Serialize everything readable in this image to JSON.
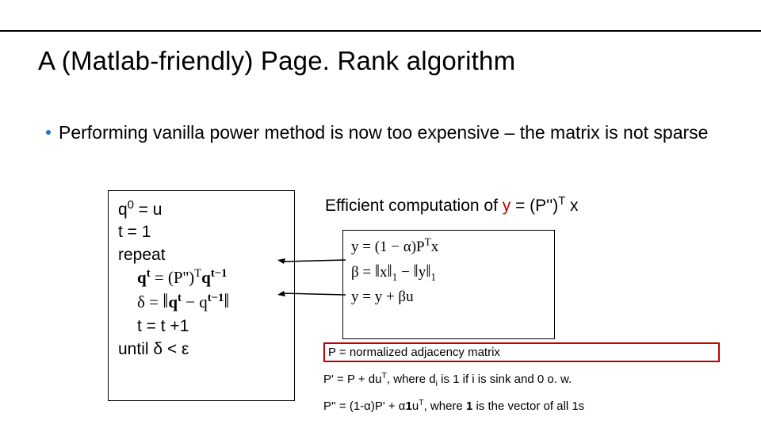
{
  "title": "A (Matlab-friendly) Page. Rank algorithm",
  "bullet": "Performing vanilla power method is now too expensive – the matrix is not sparse",
  "algo": {
    "l1a": "q",
    "l1b": "0",
    "l1c": " = u",
    "l2": "t = 1",
    "l3": "repeat",
    "l4a": "q",
    "l4b": "t",
    "l4c": " = (P'')",
    "l4d": "T",
    "l4e": "q",
    "l4f": "t−1",
    "l5a": "δ = ",
    "l5b": "q",
    "l5c": "t",
    "l5d": " − q",
    "l5e": "t−1",
    "l6": "t = t +1",
    "l7": "until δ < ε"
  },
  "eff": {
    "pre": "Efficient computation of ",
    "y": "y",
    "mid": " = (P'')",
    "sup": "T",
    "post": " x"
  },
  "eq": {
    "r1a": "y = (1 − α)P",
    "r1b": "T",
    "r1c": "x",
    "r2a": "β = ",
    "r2b": "x",
    "r2c": "1",
    "r2d": " − ",
    "r2e": "y",
    "r2f": "1",
    "r3a": "y = y + βu"
  },
  "notes": {
    "n1": "P = normalized adjacency matrix",
    "n2a": "P' = P + du",
    "n2b": "T",
    "n2c": ", where d",
    "n2d": "i",
    "n2e": " is 1 if i is sink and 0 o. w.",
    "n3a": "P'' = (1-α)P' + α",
    "n3b": "1",
    "n3c": "u",
    "n3d": "T",
    "n3e": ",  where ",
    "n3f": "1",
    "n3g": " is the vector of all 1s"
  }
}
